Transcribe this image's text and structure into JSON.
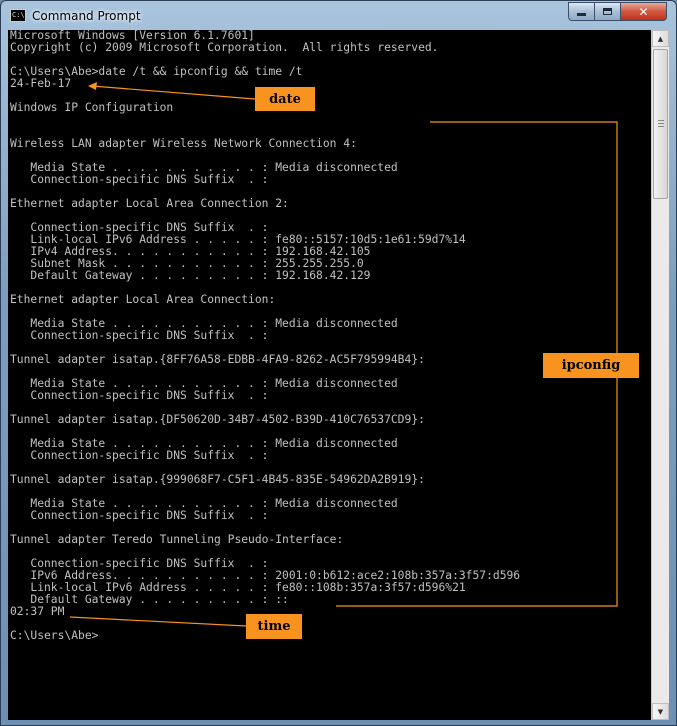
{
  "window": {
    "title": "Command Prompt",
    "icon": "cmd-icon",
    "icon_text": "C:\\"
  },
  "controls": {
    "minimize": "minimize-icon",
    "maximize": "maximize-icon",
    "close": "close-icon",
    "close_glyph": "✕"
  },
  "console": {
    "lines": [
      "Microsoft Windows [Version 6.1.7601]",
      "Copyright (c) 2009 Microsoft Corporation.  All rights reserved.",
      "",
      "C:\\Users\\Abe>date /t && ipconfig && time /t",
      "24-Feb-17",
      "",
      "Windows IP Configuration",
      "",
      "",
      "Wireless LAN adapter Wireless Network Connection 4:",
      "",
      "   Media State . . . . . . . . . . . : Media disconnected",
      "   Connection-specific DNS Suffix  . :",
      "",
      "Ethernet adapter Local Area Connection 2:",
      "",
      "   Connection-specific DNS Suffix  . :",
      "   Link-local IPv6 Address . . . . . : fe80::5157:10d5:1e61:59d7%14",
      "   IPv4 Address. . . . . . . . . . . : 192.168.42.105",
      "   Subnet Mask . . . . . . . . . . . : 255.255.255.0",
      "   Default Gateway . . . . . . . . . : 192.168.42.129",
      "",
      "Ethernet adapter Local Area Connection:",
      "",
      "   Media State . . . . . . . . . . . : Media disconnected",
      "   Connection-specific DNS Suffix  . :",
      "",
      "Tunnel adapter isatap.{8FF76A58-EDBB-4FA9-8262-AC5F795994B4}:",
      "",
      "   Media State . . . . . . . . . . . : Media disconnected",
      "   Connection-specific DNS Suffix  . :",
      "",
      "Tunnel adapter isatap.{DF50620D-34B7-4502-B39D-410C76537CD9}:",
      "",
      "   Media State . . . . . . . . . . . : Media disconnected",
      "   Connection-specific DNS Suffix  . :",
      "",
      "Tunnel adapter isatap.{999068F7-C5F1-4B45-835E-54962DA2B919}:",
      "",
      "   Media State . . . . . . . . . . . : Media disconnected",
      "   Connection-specific DNS Suffix  . :",
      "",
      "Tunnel adapter Teredo Tunneling Pseudo-Interface:",
      "",
      "   Connection-specific DNS Suffix  . :",
      "   IPv6 Address. . . . . . . . . . . : 2001:0:b612:ace2:108b:357a:3f57:d596",
      "   Link-local IPv6 Address . . . . . : fe80::108b:357a:3f57:d596%21",
      "   Default Gateway . . . . . . . . . : ::",
      "02:37 PM",
      "",
      "C:\\Users\\Abe>"
    ]
  },
  "annotations": {
    "date_label": "date",
    "ipconfig_label": "ipconfig",
    "time_label": "time",
    "color": "#f7931e"
  }
}
